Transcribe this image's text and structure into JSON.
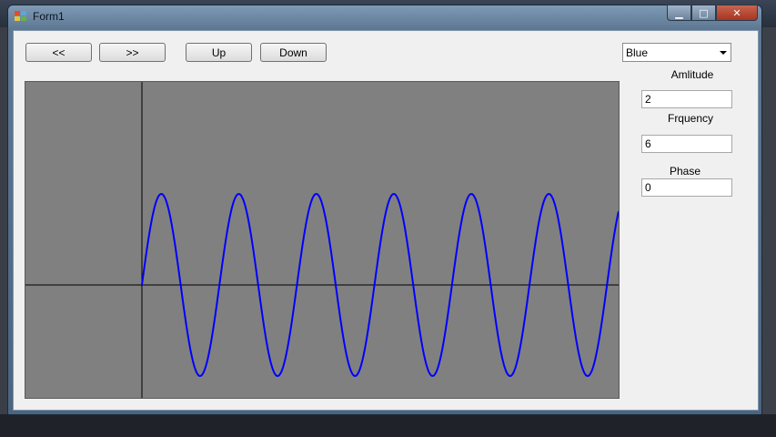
{
  "window": {
    "title": "Form1",
    "minimize_glyph": "▁",
    "maximize_glyph": "□",
    "close_glyph": "✕"
  },
  "toolbar": {
    "left_label": "<<",
    "right_label": ">>",
    "up_label": "Up",
    "down_label": "Down"
  },
  "controls": {
    "color_value": "Blue",
    "amplitude_label": "Amlitude",
    "amplitude_value": "2",
    "frequency_label": "Frquency",
    "frequency_value": "6",
    "phase_label": "Phase",
    "phase_value": "0"
  },
  "plot": {
    "background": "#808080",
    "axis_color": "#000000",
    "curve_color": "#0000ff"
  },
  "chart_data": {
    "type": "line",
    "function": "sine",
    "amplitude": 2,
    "frequency": 6,
    "phase": 0,
    "cycles_visible": 6.15,
    "grid": false
  }
}
